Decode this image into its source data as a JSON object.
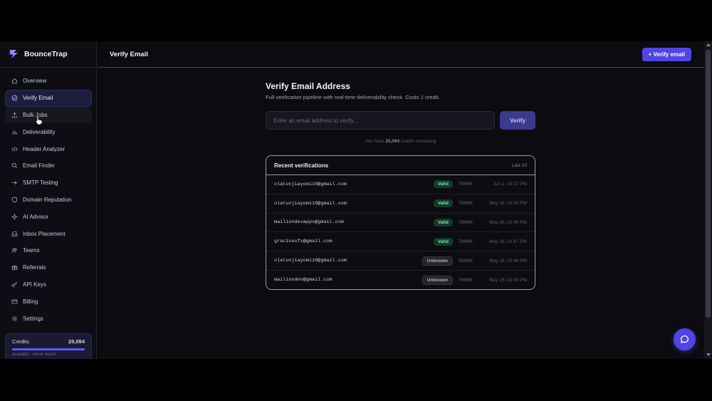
{
  "app": {
    "brand": "BounceTrap"
  },
  "sidebar": {
    "items": [
      {
        "label": "Overview",
        "icon": "home-icon"
      },
      {
        "label": "Verify Email",
        "icon": "check-circle-icon",
        "active": true
      },
      {
        "label": "Bulk Jobs",
        "icon": "upload-icon"
      },
      {
        "label": "Deliverability",
        "icon": "bar-chart-icon"
      },
      {
        "label": "Header Analyzer",
        "icon": "code-icon"
      },
      {
        "label": "Email Finder",
        "icon": "search-icon"
      },
      {
        "label": "SMTP Testing",
        "icon": "arrow-right-icon"
      },
      {
        "label": "Domain Reputation",
        "icon": "shield-icon"
      },
      {
        "label": "AI Advisor",
        "icon": "sparkle-icon"
      },
      {
        "label": "Inbox Placement",
        "icon": "inbox-icon"
      },
      {
        "label": "Teams",
        "icon": "users-icon"
      },
      {
        "label": "Referrals",
        "icon": "gift-icon"
      },
      {
        "label": "API Keys",
        "icon": "key-icon"
      },
      {
        "label": "Billing",
        "icon": "credit-card-icon"
      },
      {
        "label": "Settings",
        "icon": "gear-icon"
      }
    ],
    "credits": {
      "label": "Credits",
      "value": "25,094",
      "fill_fraction": 1.0,
      "sub": "available · never expire"
    }
  },
  "topbar": {
    "title": "Verify Email",
    "action_label": "+ Verify email"
  },
  "main": {
    "title": "Verify Email Address",
    "subtitle": "Full verification pipeline with real-time deliverability check. Costs 1 credit.",
    "input_placeholder": "Enter an email address to verify...",
    "verify_label": "Verify",
    "credits_note_pre": "You have ",
    "credits_note_value": "25,094",
    "credits_note_post": " credits remaining"
  },
  "recent": {
    "title": "Recent verifications",
    "meta": "Last 10",
    "rows": [
      {
        "email": "olatunjiayomi10@gmail.com",
        "status": "Valid",
        "score": "7000%",
        "time": "Jun 1, 03:17 PM"
      },
      {
        "email": "olatunjiayomi10@gmail.com",
        "status": "Valid",
        "score": "7000%",
        "time": "May 26, 02:50 PM"
      },
      {
        "email": "mailiondevapps@gmail.com",
        "status": "Valid",
        "score": "7000%",
        "time": "May 26, 02:48 PM"
      },
      {
        "email": "graciousfx@gmail.com",
        "status": "Valid",
        "score": "7000%",
        "time": "May 26, 02:47 PM"
      },
      {
        "email": "olatunjiayomi10@gmail.com",
        "status": "Unknown",
        "score": "3000%",
        "time": "May 26, 02:46 PM"
      },
      {
        "email": "mailiondev@gmail.com",
        "status": "Unknown",
        "score": "7000%",
        "time": "May 26, 02:09 PM"
      }
    ]
  },
  "colors": {
    "accent": "#4f46e5",
    "valid": "#7ee2b0",
    "background": "#0b0b10"
  }
}
